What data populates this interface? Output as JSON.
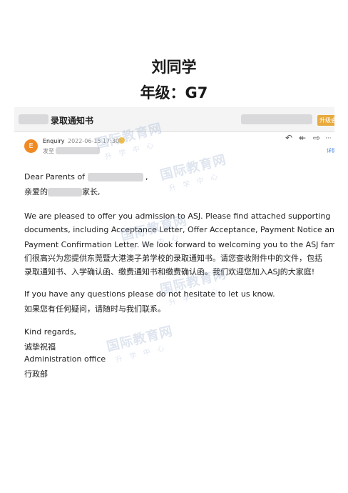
{
  "header": {
    "student": "刘同学",
    "grade": "年级：G7"
  },
  "email": {
    "subject": "录取通知书",
    "upgrade_badge": "升级会",
    "avatar_letter": "E",
    "sender": "Enquiry",
    "date": "2022-06-15 17:30",
    "to_label": "发至",
    "details_link": "详情",
    "actions": [
      {
        "name": "reply-icon",
        "glyph": "↶"
      },
      {
        "name": "reply-all-icon",
        "glyph": "↞"
      },
      {
        "name": "forward-icon",
        "glyph": "⇨"
      },
      {
        "name": "more-icon",
        "glyph": "···"
      }
    ],
    "greeting_en": "Dear Parents of",
    "greeting_en_end": ",",
    "greeting_cn_start": "亲爱的",
    "greeting_cn_end": "家长,",
    "p1_l1": "We are pleased to offer you admission to ASJ. Please find attached supporting",
    "p1_l2": "documents, including Acceptance Letter, Offer Acceptance, Payment Notice and",
    "p1_l3": "Payment Confirmation Letter. We look forward to welcoming you to the ASJ family!我",
    "p1_l4": "们很高兴为您提供东莞暨大港澳子弟学校的录取通知书。请您查收附件中的文件，包括",
    "p1_l5": "录取通知书、入学确认函、缴费通知书和缴费确认函。我们欢迎您加入ASJ的大家庭!",
    "p2_l1": "If you have any questions please do not hesitate to let us know.",
    "p2_l2": "如果您有任何疑问，请随时与我们联系。",
    "closing_en": "Kind regards,",
    "closing_cn": "诚挚祝福",
    "office_en": "Administration office",
    "office_cn": "行政部"
  },
  "watermark": {
    "main": "国际教育网",
    "sub": "升学中心"
  }
}
